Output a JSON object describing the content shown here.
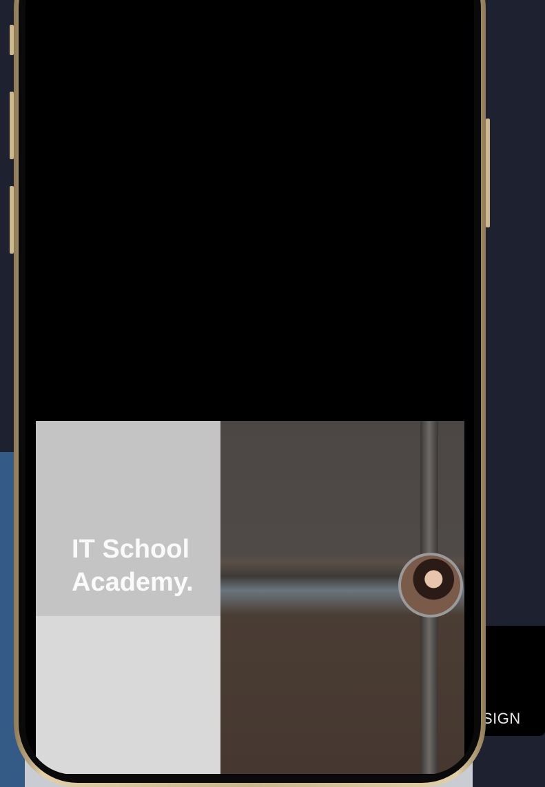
{
  "brand": {
    "line1": "IT School",
    "line2": "Academy."
  },
  "background_card": {
    "label": "SIGN"
  },
  "colors": {
    "page_background": "#1d2130",
    "left_panel": "#345a86",
    "brand_tile": "#c4c4c4",
    "light_tile": "#d9d9d9",
    "phone_frame": "#c9b58a",
    "screen": "#000000"
  },
  "icons": {
    "avatar": "user-avatar-photo"
  }
}
